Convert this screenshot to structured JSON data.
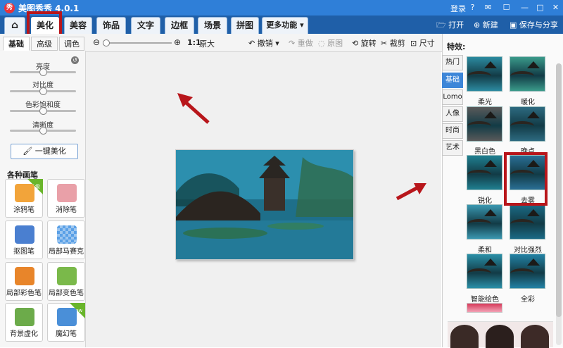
{
  "app": {
    "title": "美图秀秀 4.0.1",
    "logo_char": "秀",
    "login": "登录"
  },
  "nav": {
    "tabs": [
      "美化",
      "美容",
      "饰品",
      "文字",
      "边框",
      "场景",
      "拼图",
      "更多功能 ▾"
    ],
    "active": "美化",
    "open_label": "打开",
    "new_label": "新建",
    "save_label": "保存与分享"
  },
  "subtabs": [
    "基础",
    "高级",
    "调色"
  ],
  "toolbar": {
    "ratio": "1:1",
    "original": "原大",
    "undo": "撤销",
    "redo": "重做",
    "reset": "原图",
    "rotate": "旋转",
    "crop": "裁剪",
    "size": "尺寸"
  },
  "adjust": [
    {
      "label": "亮度",
      "value": 0.5
    },
    {
      "label": "对比度",
      "value": 0.5
    },
    {
      "label": "色彩饱和度",
      "value": 0.5
    },
    {
      "label": "清晰度",
      "value": 0.5
    }
  ],
  "zoom_level": 0.0,
  "one_key": "一键美化",
  "brushes_title": "各种画笔",
  "brushes": [
    {
      "label": "涂鸦笔",
      "badge": "升级",
      "color": "#f2a43a"
    },
    {
      "label": "消除笔",
      "badge": "",
      "color": "#e9a0a8"
    },
    {
      "label": "抠图笔",
      "badge": "",
      "color": "#4a7fd0"
    },
    {
      "label": "局部马赛克",
      "badge": "",
      "color": "#5aa0e6"
    },
    {
      "label": "局部彩色笔",
      "badge": "",
      "color": "#e8852a"
    },
    {
      "label": "局部变色笔",
      "badge": "",
      "color": "#7ab94a"
    },
    {
      "label": "背景虚化",
      "badge": "",
      "color": "#6cab4a"
    },
    {
      "label": "魔幻笔",
      "badge": "new",
      "color": "#4a8fd8"
    }
  ],
  "effects": {
    "title": "特效:",
    "categories": [
      "热门",
      "基础",
      "Lomo",
      "人像",
      "时尚",
      "艺术"
    ],
    "active_category": "基础",
    "items": [
      {
        "label": "柔光",
        "tint": "#2c8aa0"
      },
      {
        "label": "暖化",
        "tint": "#3a9a8a"
      },
      {
        "label": "黑白色",
        "tint": "#5a5a5a"
      },
      {
        "label": "晚点",
        "tint": "#2d6a80"
      },
      {
        "label": "锐化",
        "tint": "#1f7f90"
      },
      {
        "label": "去雾",
        "tint": "#2a6f95"
      },
      {
        "label": "柔和",
        "tint": "#3a97b0"
      },
      {
        "label": "对比强烈",
        "tint": "#1a6a85"
      },
      {
        "label": "智能绘色",
        "tint": "#2a90a8"
      },
      {
        "label": "全彩",
        "tint": "#2382a5"
      }
    ]
  },
  "colors": {
    "title_bar": "#2f7fd8",
    "nav_bar": "#1f5fa8",
    "highlight": "#b8161b",
    "accent": "#3d86d8"
  }
}
